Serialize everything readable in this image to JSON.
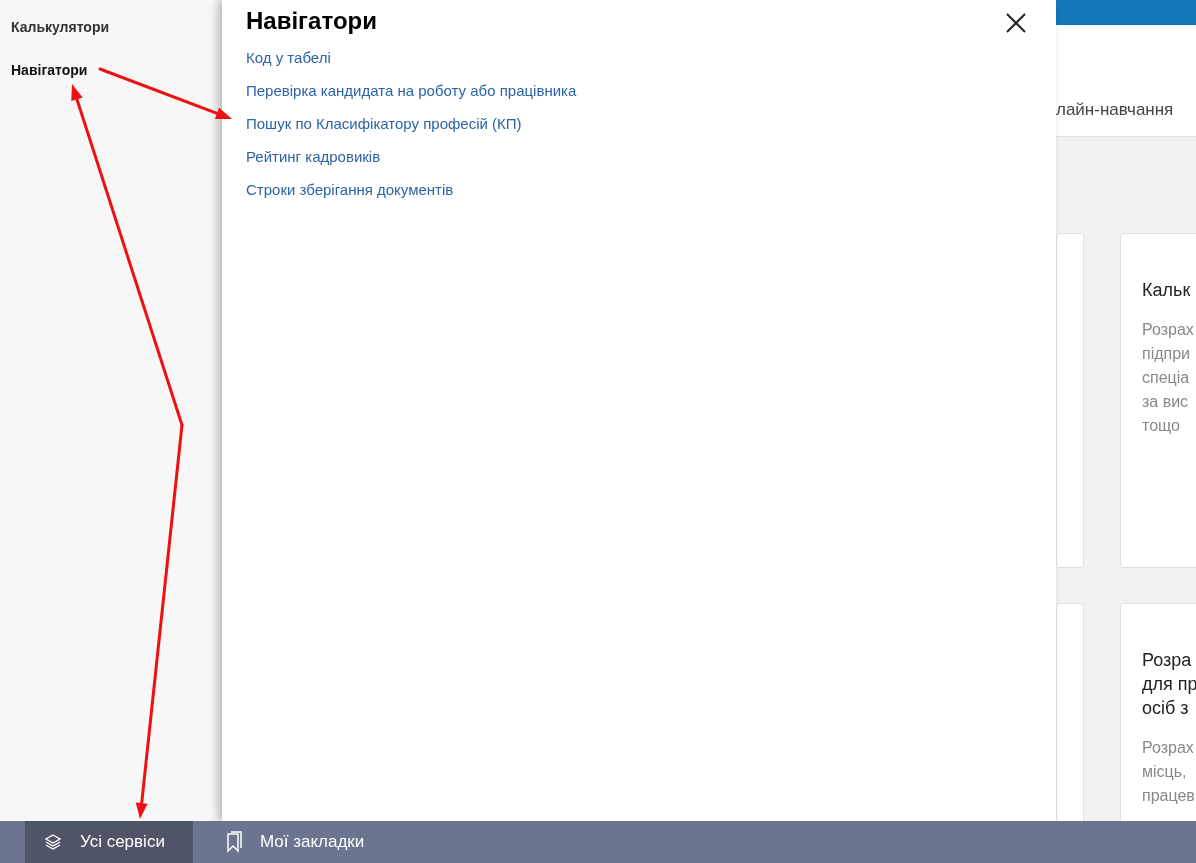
{
  "sidebar": {
    "items": [
      {
        "label": "Калькулятори",
        "selected": false
      },
      {
        "label": "Навігатори",
        "selected": true
      }
    ]
  },
  "panel": {
    "title": "Навігатори",
    "links": [
      "Код у табелі",
      "Перевірка кандидата на роботу або працівника",
      "Пошук по Класифікатору професій (КП)",
      "Рейтинг кадровиків",
      "Строки зберігання документів"
    ]
  },
  "background": {
    "tab": "лайн-навчання",
    "cards": [
      {
        "title_lines": [
          "Кальк"
        ],
        "description_lines": [
          "Розрах",
          "підпри",
          "спеціа",
          "за вис",
          "тощо"
        ]
      },
      {
        "title_lines": [
          "Розра",
          "для пр",
          "осіб з"
        ],
        "description_lines": [
          "Розрах",
          "місць,",
          "працев"
        ]
      }
    ]
  },
  "bottom_bar": {
    "items": [
      {
        "label": "Усі сервіси",
        "kind": "services",
        "selected": true
      },
      {
        "label": "Мої закладки",
        "kind": "bookmarks",
        "selected": false
      }
    ]
  },
  "annotations": [
    {
      "kind": "arrow"
    },
    {
      "kind": "arrow"
    },
    {
      "kind": "arrow"
    }
  ]
}
